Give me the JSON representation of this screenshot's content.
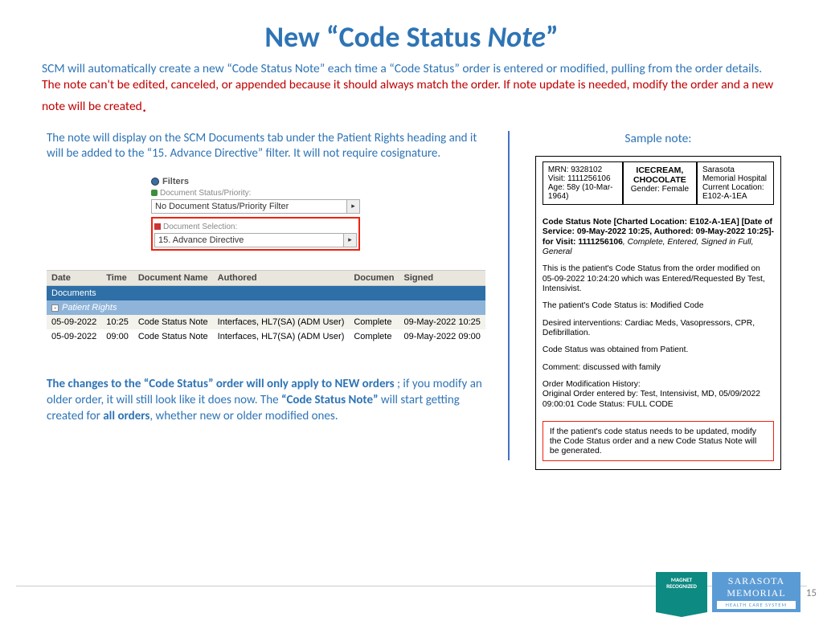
{
  "title": {
    "pre": "New “Code Status ",
    "italic": "Note",
    "post": "”"
  },
  "intro": {
    "blue": "SCM will automatically create a new “Code Status Note” each time a “Code Status” order is entered or modified, pulling from the order details. ",
    "red": "The note can't be edited, canceled, or appended because it should always match the order.  If note update is needed, modify the order and a new note will be created"
  },
  "left": {
    "para1": "The note will display on the SCM Documents tab under the Patient Rights heading and it will be added to the “15. Advance Directive” filter.  It will not require cosignature.",
    "filters": {
      "heading": "Filters",
      "label1": "Document Status/Priority:",
      "value1": "No Document Status/Priority Filter",
      "label2": "Document Selection:",
      "value2": "15. Advance Directive"
    },
    "table": {
      "headers": [
        "Date",
        "Time",
        "Document Name",
        "Authored",
        "Documen",
        "Signed"
      ],
      "band1": "Documents",
      "band2": "Patient Rights",
      "rows": [
        {
          "date": "05-09-2022",
          "time": "10:25",
          "doc": "Code Status Note",
          "auth": "Interfaces, HL7(SA) (ADM User)",
          "st": "Complete",
          "sig": "09-May-2022 10:25"
        },
        {
          "date": "05-09-2022",
          "time": "09:00",
          "doc": "Code Status Note",
          "auth": "Interfaces, HL7(SA) (ADM User)",
          "st": "Complete",
          "sig": "09-May-2022 09:00"
        }
      ]
    },
    "para2": {
      "b1": "The changes to the “Code Status” order will only apply to NEW orders",
      "m1": " ; if you modify an older order, it will still look like it does now.  The ",
      "b2": "“Code Status Note”",
      "m2": " will start getting created for ",
      "b3": "all orders",
      "m3": ", whether new or older modified ones."
    }
  },
  "right": {
    "heading": "Sample note:",
    "header": {
      "mrn": "MRN: 9328102",
      "visit": "Visit: 1111256106",
      "age": "Age: 58y (10-Mar-1964)",
      "name": "ICECREAM, CHOCOLATE",
      "gender": "Gender: Female",
      "hosp": "Sarasota Memorial Hospital",
      "loc1": "Current Location:",
      "loc2": "E102-A-1EA"
    },
    "body": {
      "line1a": "Code Status Note [Charted Location: E102-A-1EA] [Date of Service: 09-May-2022 10:25, Authored: 09-May-2022 10:25]- for Visit: 1111256106",
      "line1b": ", Complete, Entered, Signed in Full, General",
      "p1": "This is the patient's Code Status from the order modified on 05-09-2022 10:24:20 which was Entered/Requested By Test, Intensivist.",
      "p2": "The patient's Code Status is: Modified Code",
      "p3": "Desired interventions: Cardiac Meds, Vasopressors, CPR, Defibrillation.",
      "p4": "Code Status was obtained from Patient.",
      "p5": "Comment: discussed with family",
      "p6": "Order Modification History:",
      "p7": "Original Order entered by: Test, Intensivist, MD, 05/09/2022 09:00:01  Code Status: FULL CODE",
      "footnote": "If the patient's code status needs to be updated, modify the Code Status order and a new Code Status Note will be generated."
    }
  },
  "footer": {
    "page": "15",
    "magnet1": "MAGNET",
    "magnet2": "RECOGNIZED",
    "smh1": "SARASOTA",
    "smh2": "MEMORIAL",
    "smh3": "HEALTH CARE SYSTEM"
  }
}
